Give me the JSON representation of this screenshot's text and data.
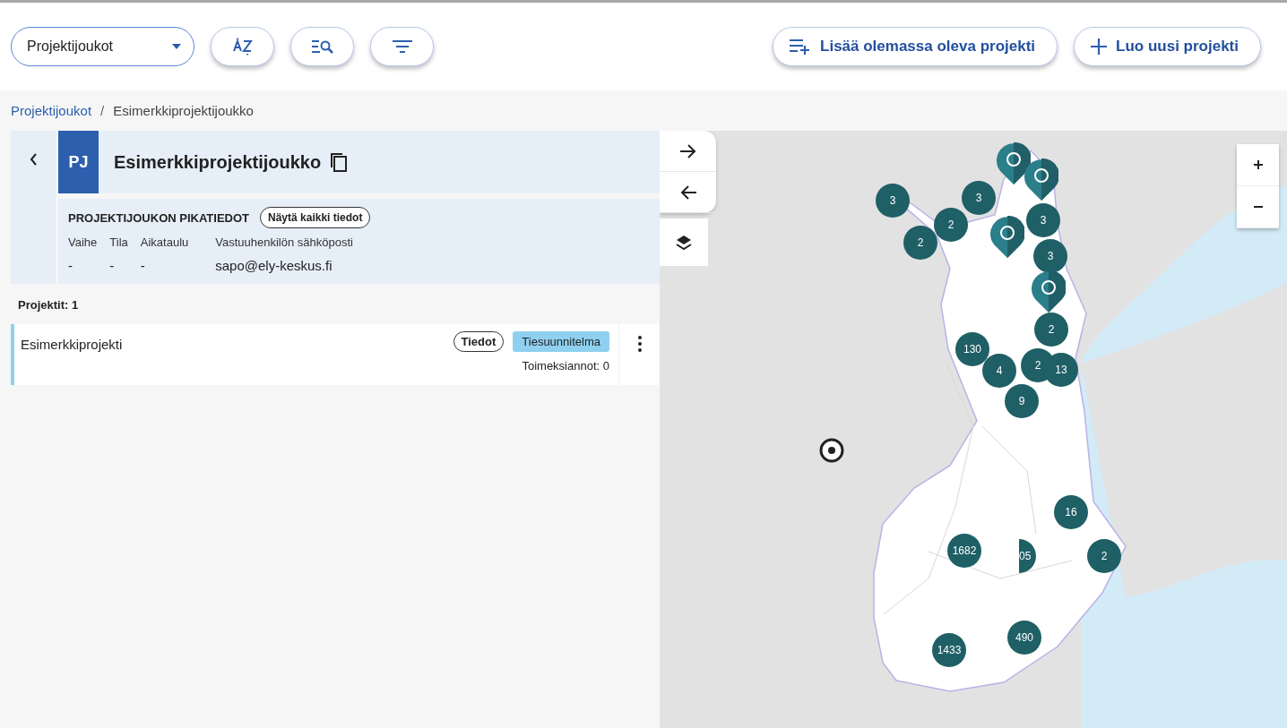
{
  "toolbar": {
    "group_select": {
      "value": "Projektijoukot"
    },
    "buttons": [
      {
        "kind": "add-list",
        "label": "Lisää olemassa oleva projekti"
      },
      {
        "kind": "plus",
        "label": "Luo uusi projekti"
      }
    ]
  },
  "breadcrumb": [
    {
      "label": "Projektijoukot",
      "kind": "link"
    },
    {
      "label": "/",
      "kind": "separator"
    },
    {
      "label": "Esimerkkiprojektijoukko",
      "kind": "current"
    }
  ],
  "group": {
    "badge": "PJ",
    "name": "Esimerkkiprojektijoukko",
    "quick_info": {
      "title": "PROJEKTIJOUKON PIKATIEDOT",
      "button": "Näytä kaikki tiedot",
      "fields": [
        {
          "label": "Vaihe",
          "value": "-"
        },
        {
          "label": "Tila",
          "value": "-"
        },
        {
          "label": "Aikataulu",
          "value": "-"
        },
        {
          "label": "Vastuuhenkilön sähköposti",
          "value": "sapo@ely-keskus.fi"
        }
      ]
    }
  },
  "projects": {
    "count_label": "Projektit: 1",
    "items": [
      {
        "name": "Esimerkkiprojekti",
        "info_button": "Tiedot",
        "tag": "Tiesuunnitelma",
        "assignments": "Toimeksiannot: 0"
      }
    ]
  },
  "map": {
    "markers": [
      {
        "kind": "cluster",
        "count": "3"
      },
      {
        "kind": "cluster",
        "count": "2"
      },
      {
        "kind": "cluster",
        "count": "2"
      },
      {
        "kind": "cluster",
        "count": "3"
      },
      {
        "kind": "cluster",
        "count": "3"
      },
      {
        "kind": "cluster",
        "count": "3"
      },
      {
        "kind": "cluster",
        "count": "2"
      },
      {
        "kind": "cluster",
        "count": "130"
      },
      {
        "kind": "cluster",
        "count": "4"
      },
      {
        "kind": "cluster",
        "count": "2"
      },
      {
        "kind": "cluster",
        "count": "13"
      },
      {
        "kind": "cluster",
        "count": "9"
      },
      {
        "kind": "cluster",
        "count": "16"
      },
      {
        "kind": "cluster",
        "count": "1682"
      },
      {
        "kind": "cluster",
        "count": "05"
      },
      {
        "kind": "cluster",
        "count": "2"
      },
      {
        "kind": "cluster",
        "count": "490"
      },
      {
        "kind": "cluster",
        "count": "1433"
      },
      {
        "kind": "pin"
      },
      {
        "kind": "pin"
      },
      {
        "kind": "pin"
      },
      {
        "kind": "pin"
      }
    ]
  }
}
